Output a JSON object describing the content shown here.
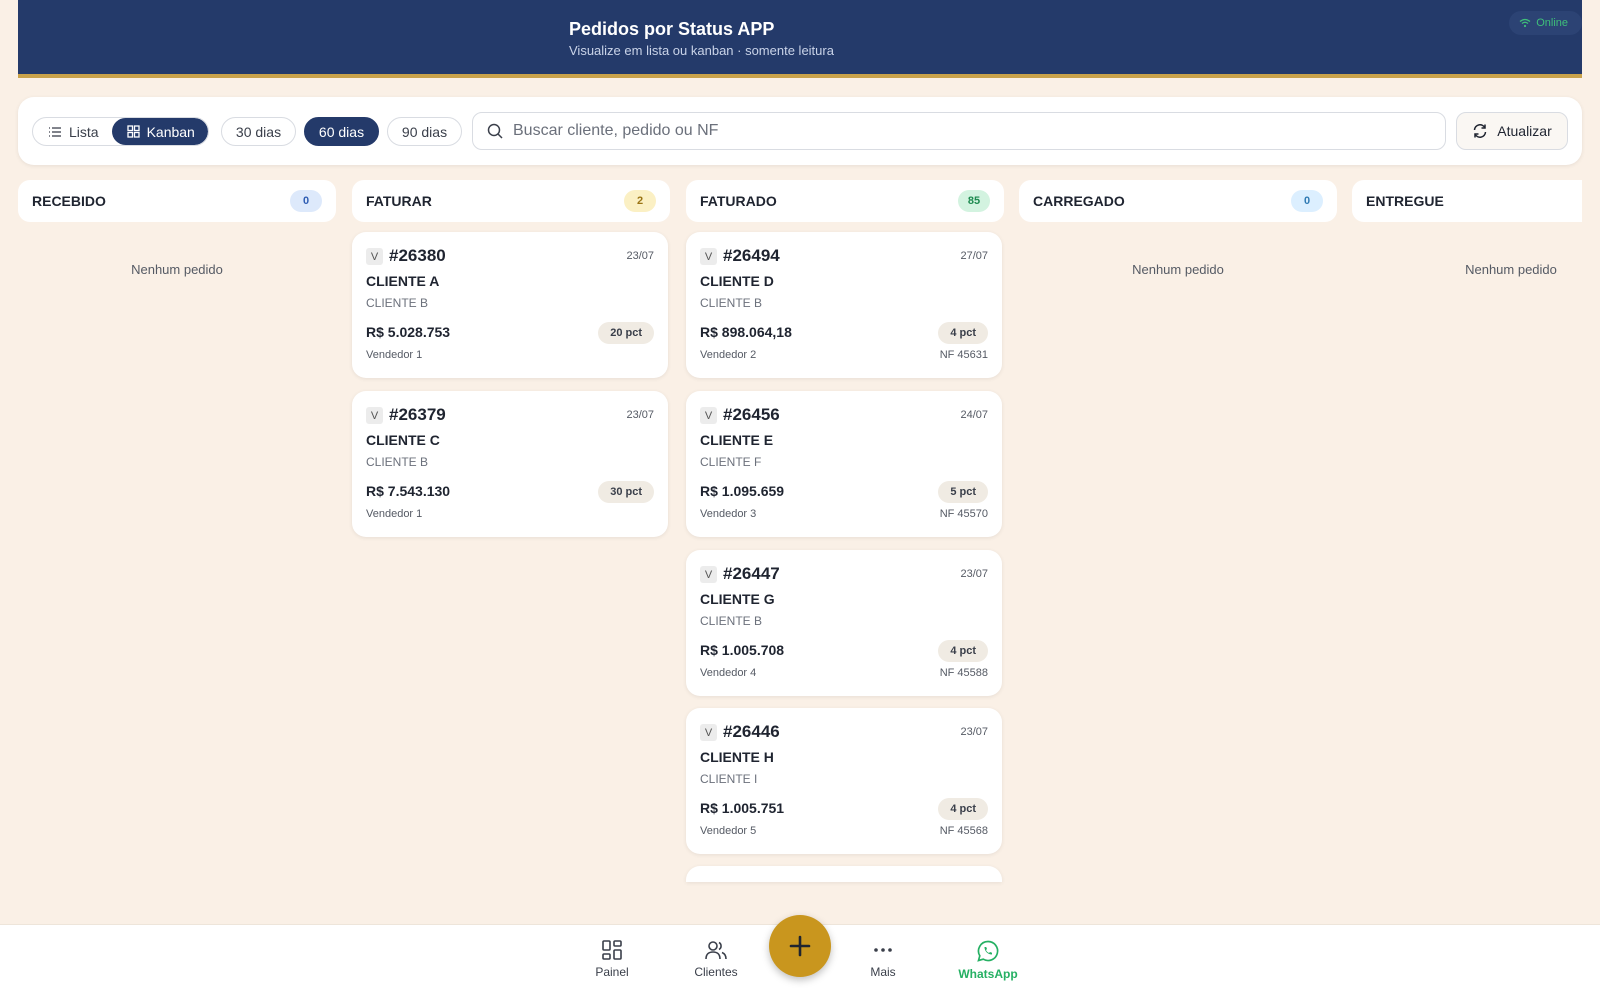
{
  "header": {
    "title": "Pedidos por Status APP",
    "subtitle": "Visualize em lista ou kanban · somente leitura",
    "status": "Online"
  },
  "toolbar": {
    "view_list": "Lista",
    "view_kanban": "Kanban",
    "active_view": "Kanban",
    "periods": [
      "30 dias",
      "60 dias",
      "90 dias"
    ],
    "active_period": "60 dias",
    "search_placeholder": "Buscar cliente, pedido ou NF",
    "refresh_label": "Atualizar"
  },
  "columns": [
    {
      "name": "RECEBIDO",
      "count": "0",
      "empty_text": "Nenhum pedido"
    },
    {
      "name": "FATURAR",
      "count": "2"
    },
    {
      "name": "FATURADO",
      "count": "85"
    },
    {
      "name": "CARREGADO",
      "count": "0",
      "empty_text": "Nenhum pedido"
    },
    {
      "name": "ENTREGUE",
      "empty_text": "Nenhum pedido"
    }
  ],
  "faturar_cards": [
    {
      "tag": "V",
      "number": "#26380",
      "date": "23/07",
      "client": "CLIENTE A",
      "sub": "CLIENTE B",
      "value": "R$ 5.028.753",
      "pct": "20 pct",
      "seller": "Vendedor 1"
    },
    {
      "tag": "V",
      "number": "#26379",
      "date": "23/07",
      "client": "CLIENTE C",
      "sub": "CLIENTE B",
      "value": "R$ 7.543.130",
      "pct": "30 pct",
      "seller": "Vendedor 1"
    }
  ],
  "faturado_cards": [
    {
      "tag": "V",
      "number": "#26494",
      "date": "27/07",
      "client": "CLIENTE D",
      "sub": "CLIENTE B",
      "value": "R$ 898.064,18",
      "pct": "4 pct",
      "seller": "Vendedor 2",
      "nf": "NF 45631"
    },
    {
      "tag": "V",
      "number": "#26456",
      "date": "24/07",
      "client": "CLIENTE E",
      "sub": "CLIENTE F",
      "value": "R$ 1.095.659",
      "pct": "5 pct",
      "seller": "Vendedor 3",
      "nf": "NF 45570"
    },
    {
      "tag": "V",
      "number": "#26447",
      "date": "23/07",
      "client": "CLIENTE G",
      "sub": "CLIENTE B",
      "value": "R$ 1.005.708",
      "pct": "4 pct",
      "seller": "Vendedor 4",
      "nf": "NF 45588"
    },
    {
      "tag": "V",
      "number": "#26446",
      "date": "23/07",
      "client": "CLIENTE H",
      "sub": "CLIENTE I",
      "value": "R$ 1.005.751",
      "pct": "4 pct",
      "seller": "Vendedor 5",
      "nf": "NF 45568"
    }
  ],
  "nav": {
    "painel": "Painel",
    "clientes": "Clientes",
    "mais": "Mais",
    "whatsapp": "WhatsApp"
  },
  "colors": {
    "header": "#243a6a",
    "accent": "#c9a24a",
    "fab": "#c9961e",
    "background": "#faf0e6",
    "whatsapp": "#25b063",
    "badge_blue": "#dde9fb",
    "badge_yellow": "#fbf0c4",
    "badge_green": "#d3f3e0"
  },
  "icons": {
    "list": "list-icon",
    "kanban": "grid-icon",
    "search": "search-icon",
    "refresh": "refresh-icon",
    "wifi": "wifi-icon",
    "painel": "dashboard-icon",
    "clientes": "users-icon",
    "mais": "more-icon",
    "whatsapp": "whatsapp-icon",
    "fab": "plus-icon"
  }
}
